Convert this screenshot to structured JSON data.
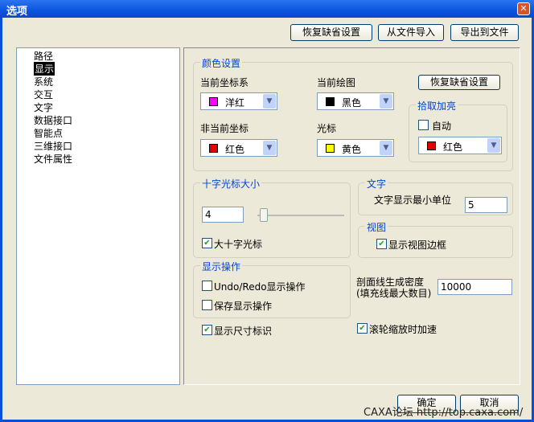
{
  "window": {
    "title": "选项"
  },
  "toolbar": {
    "restore": "恢复缺省设置",
    "import": "从文件导入",
    "export": "导出到文件"
  },
  "tree": [
    "路径",
    "显示",
    "系统",
    "交互",
    "文字",
    "数据接口",
    "智能点",
    "三维接口",
    "文件属性"
  ],
  "colors": {
    "title": "颜色设置",
    "current_coord": {
      "label": "当前坐标系",
      "value": "洋红",
      "swatch": "#ff00ff"
    },
    "current_draw": {
      "label": "当前绘图",
      "value": "黑色",
      "swatch": "#000000"
    },
    "noncurrent_coord": {
      "label": "非当前坐标",
      "value": "红色",
      "swatch": "#e00000"
    },
    "cursor": {
      "label": "光标",
      "value": "黄色",
      "swatch": "#ffff00"
    },
    "restore": "恢复缺省设置",
    "pick": {
      "title": "拾取加亮",
      "auto_label": "自动",
      "auto": false,
      "value": "红色",
      "swatch": "#e00000"
    }
  },
  "crosshair": {
    "title": "十字光标大小",
    "value": "4",
    "large_label": "大十字光标",
    "large": true
  },
  "text": {
    "title": "文字",
    "min_label": "文字显示最小单位",
    "min_value": "5"
  },
  "view": {
    "title": "视图",
    "border_label": "显示视图边框",
    "border": true
  },
  "display_ops": {
    "title": "显示操作",
    "undo_label": "Undo/Redo显示操作",
    "undo": false,
    "save_label": "保存显示操作",
    "save": false
  },
  "hatch": {
    "label1": "剖面线生成密度",
    "label2": "(填充线最大数目)",
    "value": "10000"
  },
  "show_dim": {
    "label": "显示尺寸标识",
    "checked": true
  },
  "wheel": {
    "label": "滚轮缩放时加速",
    "checked": true
  },
  "footer": {
    "ok": "确定",
    "cancel": "取消"
  },
  "watermark": "CAXA论坛 http://top.caxa.com/"
}
